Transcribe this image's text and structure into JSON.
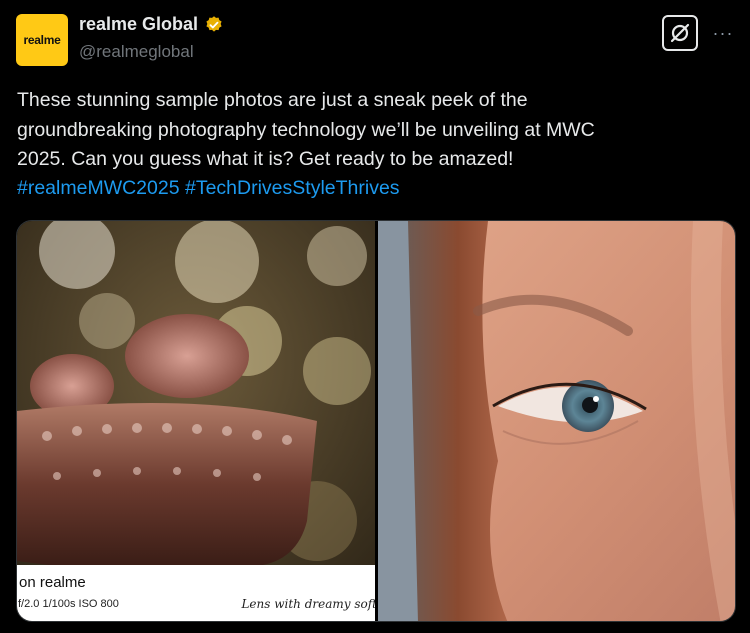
{
  "author": {
    "avatar_text": "realme",
    "display_name": "realme Global",
    "handle": "@realmeglobal",
    "avatar_color": "#ffc915",
    "verified_color": "#e8b003"
  },
  "actions": {
    "grok_icon": "grok-icon",
    "more_label": "···"
  },
  "tweet": {
    "text": "These stunning sample photos are just a sneak peek of the\ngroundbreaking photography technology we’ll be unveiling at MWC\n2025. Can you guess what it is? Get ready to be amazed!",
    "hashtags": [
      "#realmeMWC2025",
      "#TechDrivesStyleThrives"
    ],
    "hashtag_color": "#1d9bf0"
  },
  "media": {
    "left_caption": {
      "title": "on realme",
      "meta": "f/2.0  1/100s  ISO 800",
      "lens": "Lens with dreamy soft"
    }
  }
}
